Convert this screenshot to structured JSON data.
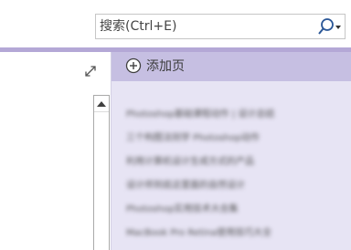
{
  "search": {
    "placeholder": "搜索(Ctrl+E)"
  },
  "pages_panel": {
    "add_page_label": "添加页",
    "items": [
      "Photoshop基础课程动作 | 设计总结",
      "三个构图法则学 Photoshop动作",
      "利用计算机设计生成方式的产品",
      "设计师到底这里面的自然设计",
      "Photoshop实用技术大合集",
      "MacBook Pro Retina使用技巧大全"
    ]
  },
  "icons": {
    "search": "search-icon",
    "search_dropdown": "chevron-down-icon",
    "expand": "expand-diagonal-icon",
    "add_page": "plus-circle-icon",
    "scroll_up": "triangle-up-icon"
  },
  "colors": {
    "ribbon_accent": "#b4a8d6",
    "add_page_row": "#c6bfe2",
    "pages_panel_bg": "#e7e4f4",
    "search_icon": "#2b5797"
  }
}
